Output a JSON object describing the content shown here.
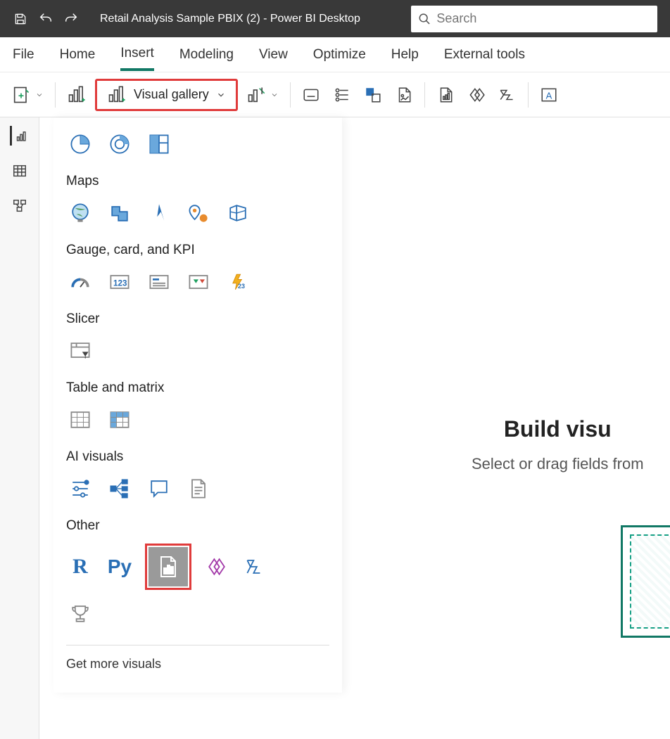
{
  "titlebar": {
    "title": "Retail Analysis Sample PBIX (2) - Power BI Desktop",
    "search_placeholder": "Search"
  },
  "menu": {
    "items": [
      "File",
      "Home",
      "Insert",
      "Modeling",
      "View",
      "Optimize",
      "Help",
      "External tools"
    ],
    "active": "Insert"
  },
  "ribbon": {
    "visual_gallery_label": "Visual gallery"
  },
  "gallery": {
    "sections": {
      "maps": "Maps",
      "gauge": "Gauge, card, and KPI",
      "slicer": "Slicer",
      "table": "Table and matrix",
      "ai": "AI visuals",
      "other": "Other"
    },
    "get_more": "Get more visuals"
  },
  "canvas": {
    "build_title": "Build visu",
    "build_subtitle": "Select or drag fields from"
  }
}
